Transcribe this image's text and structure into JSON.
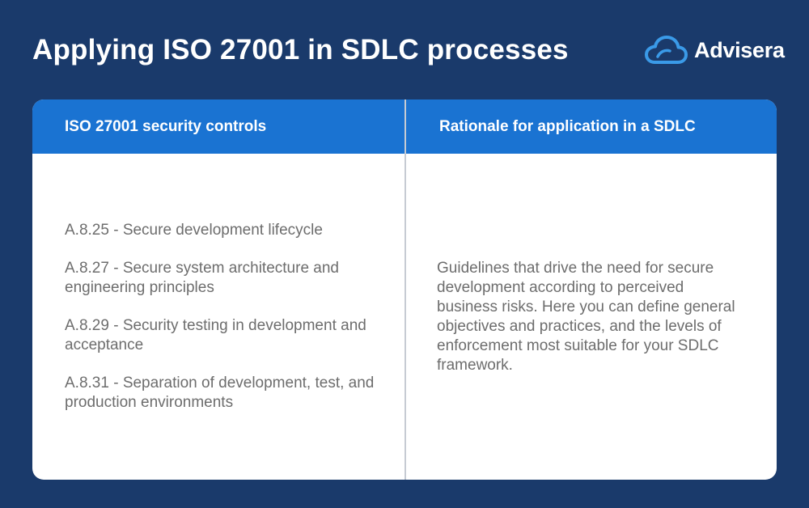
{
  "title": "Applying ISO 27001 in SDLC processes",
  "logo": {
    "text": "Advisera",
    "icon": "cloud-logo-icon",
    "icon_color": "#3a9ae8"
  },
  "colors": {
    "background": "#1a3a6b",
    "header": "#1a73d2",
    "card": "#ffffff",
    "body_text": "#6d6d6d"
  },
  "table": {
    "headers": [
      "ISO 27001 security controls",
      "Rationale for application in a SDLC"
    ],
    "controls": [
      "A.8.25 - Secure development lifecycle",
      "A.8.27 - Secure system architecture and engineering principles",
      "A.8.29 - Security testing in development and acceptance",
      "A.8.31 - Separation of development, test, and production environments"
    ],
    "rationale": "Guidelines that drive the need for secure development according to perceived business risks. Here you can define general objectives and practices, and the levels of enforcement most suitable for your SDLC framework."
  }
}
